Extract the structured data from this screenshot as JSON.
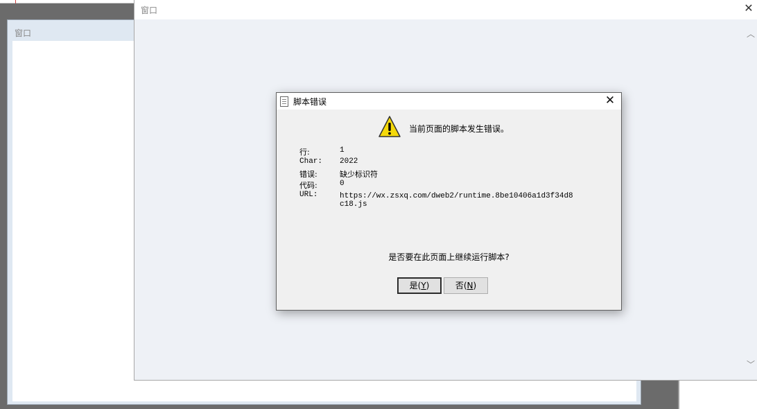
{
  "back_window": {
    "title": "窗口"
  },
  "front_window": {
    "title": "窗口",
    "close_glyph": "✕",
    "scroll_up_glyph": "︿",
    "scroll_down_glyph": "﹀"
  },
  "dialog": {
    "title": "脚本错误",
    "close_glyph": "✕",
    "message": "当前页面的脚本发生错误。",
    "fields": [
      {
        "label": "行:",
        "value": "1"
      },
      {
        "label": "Char:",
        "value": "2022"
      },
      {
        "label": "错误:",
        "value": "缺少标识符"
      },
      {
        "label": "代码:",
        "value": "0"
      },
      {
        "label": "URL:",
        "value": "https://wx.zsxq.com/dweb2/runtime.8be10406a1d3f34d8c18.js"
      }
    ],
    "question": "是否要在此页面上继续运行脚本?",
    "yes_button": {
      "label": "是",
      "accel": "Y"
    },
    "no_button": {
      "label": "否",
      "accel": "N"
    }
  },
  "colors": {
    "warning_yellow": "#f5d90a",
    "dialog_bg": "#f0f0f0",
    "window_bg": "#eef1f6"
  }
}
